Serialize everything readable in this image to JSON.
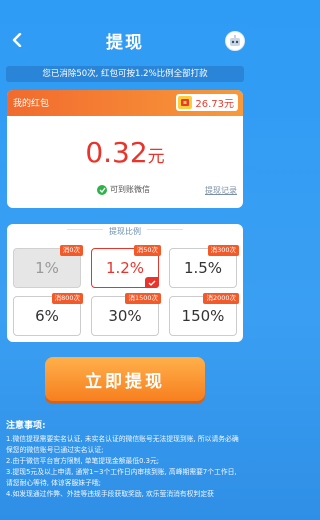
{
  "header": {
    "title": "提现",
    "back_icon": "chevron-left-icon",
    "avatar_icon": "robot-avatar-icon"
  },
  "banner": "您已消除50次, 红包可按1.2%比例全部打款",
  "wallet": {
    "label": "我的红包",
    "balance": "26.73元",
    "coin_icon": "coin-icon",
    "amount": "0.32",
    "amount_unit": "元",
    "wechat_text": "可到账微信",
    "record_link": "提现记录"
  },
  "ratio": {
    "title": "提现比例",
    "options": [
      {
        "tag": "消0次",
        "value": "1%",
        "state": "disabled"
      },
      {
        "tag": "消50次",
        "value": "1.2%",
        "state": "selected"
      },
      {
        "tag": "消300次",
        "value": "1.5%",
        "state": "normal"
      },
      {
        "tag": "消800次",
        "value": "6%",
        "state": "normal"
      },
      {
        "tag": "消1500次",
        "value": "30%",
        "state": "normal"
      },
      {
        "tag": "消2000次",
        "value": "150%",
        "state": "normal"
      }
    ]
  },
  "submit_label": "立即提现",
  "notes": {
    "title": "注意事项:",
    "items": [
      "1.微信提现需要实名认证, 未实名认证的微信账号无法提现到账, 所以请务必确保您的微信账号已通过实名认证;",
      "2.由于微信平台官方限制, 单笔提现金额最低0.3元;",
      "3.提现5元及以上申请, 通常1~3个工作日内审核到账, 高峰期需要7个工作日, 请您耐心等待, 体谅客服妹子哦;",
      "4.如发现通过作弊、外挂等违规手段获取奖励, 欢乐萤消消有权判定获"
    ]
  },
  "colors": {
    "accent_red": "#e8342a",
    "header_orange": "#f26a2e",
    "button_orange": "#f77f1f",
    "background_blue": "#2e9bf5"
  }
}
